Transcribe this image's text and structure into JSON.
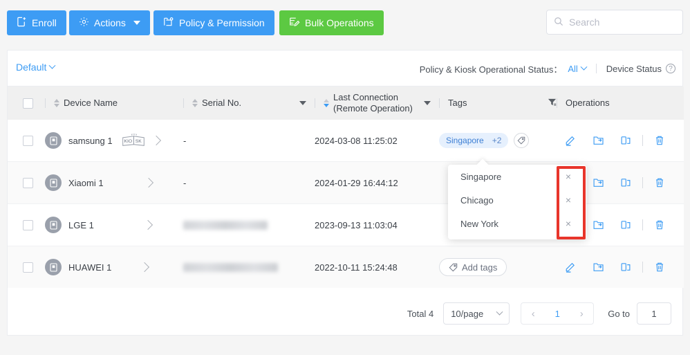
{
  "toolbar": {
    "enroll_label": "Enroll",
    "actions_label": "Actions",
    "policy_label": "Policy & Permission",
    "bulk_label": "Bulk Operations",
    "search_placeholder": "Search",
    "colors": {
      "primary_blue": "#3d9cf4",
      "green": "#5cc942",
      "link_blue": "#3d9cf4",
      "highlight_red": "#e8352b",
      "tag_chip_bg": "#e6f0fd",
      "tag_chip_text": "#3d7fd4"
    }
  },
  "filterbar": {
    "view_label": "Default",
    "status_label": "Policy & Kiosk Operational Status：",
    "status_value": "All",
    "device_status_label": "Device Status"
  },
  "table": {
    "columns": [
      {
        "key": "checkbox",
        "label": ""
      },
      {
        "key": "device_name",
        "label": "Device Name"
      },
      {
        "key": "serial_no",
        "label": "Serial No."
      },
      {
        "key": "last_connection",
        "label": "Last Connection",
        "label2": "(Remote Operation)"
      },
      {
        "key": "tags",
        "label": "Tags"
      },
      {
        "key": "operations",
        "label": "Operations"
      }
    ],
    "rows": [
      {
        "device_name": "samsung 1",
        "kiosk_badge": "KIOSK",
        "serial_no": "-",
        "serial_redacted": false,
        "last_connection": "2024-03-08 11:25:02",
        "tag_primary": "Singapore",
        "tag_more": "+2",
        "has_tags": true
      },
      {
        "device_name": "Xiaomi 1",
        "kiosk_badge": "",
        "serial_no": "-",
        "serial_redacted": false,
        "last_connection": "2024-01-29 16:44:12",
        "tag_primary": "",
        "tag_more": "",
        "has_tags": false
      },
      {
        "device_name": "LGE 1",
        "kiosk_badge": "",
        "serial_no": "",
        "serial_redacted": true,
        "last_connection": "2023-09-13 11:03:04",
        "tag_primary": "",
        "tag_more": "",
        "has_tags": false
      },
      {
        "device_name": "HUAWEI 1",
        "kiosk_badge": "",
        "serial_no": "",
        "serial_redacted": true,
        "last_connection": "2022-10-11 15:24:48",
        "tag_primary": "",
        "tag_more": "",
        "has_tags": false
      }
    ],
    "add_tags_label": "Add tags"
  },
  "tag_popover": {
    "items": [
      {
        "label": "Singapore",
        "remove": "×"
      },
      {
        "label": "Chicago",
        "remove": "×"
      },
      {
        "label": "New York",
        "remove": "×"
      }
    ]
  },
  "pagination": {
    "total_label": "Total 4",
    "page_size": "10/page",
    "prev": "‹",
    "current_page": "1",
    "next": "›",
    "goto_label": "Go to",
    "goto_value": "1"
  }
}
